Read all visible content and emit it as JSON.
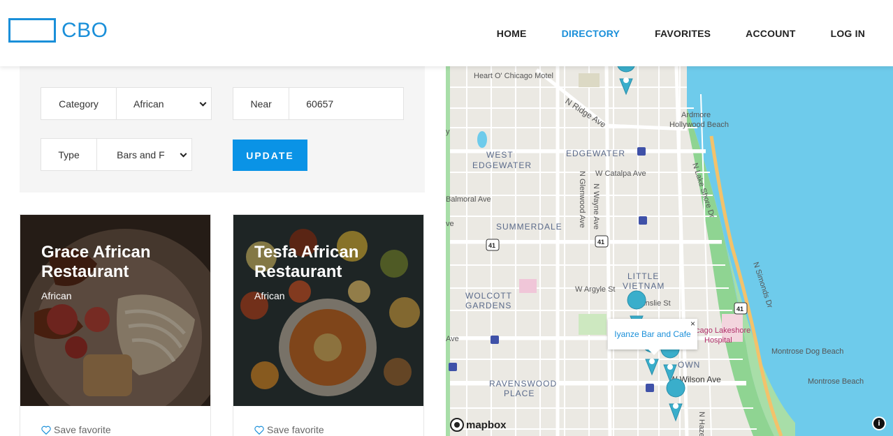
{
  "brand": {
    "name": "CBO",
    "color": "#1a8fd9"
  },
  "nav": {
    "items": [
      {
        "label": "HOME",
        "active": false
      },
      {
        "label": "DIRECTORY",
        "active": true
      },
      {
        "label": "FAVORITES",
        "active": false
      },
      {
        "label": "ACCOUNT",
        "active": false
      },
      {
        "label": "LOG IN",
        "active": false
      }
    ]
  },
  "filters": {
    "category": {
      "label": "Category",
      "value": "African"
    },
    "near": {
      "label": "Near",
      "value": "60657"
    },
    "type": {
      "label": "Type",
      "value": "Bars and F"
    },
    "update_label": "UPDATE",
    "accent": "#0a93e6"
  },
  "cards": [
    {
      "title": "Grace African Restaurant",
      "category": "African",
      "favorite_label": "Save favorite"
    },
    {
      "title": "Tesfa African Restaurant",
      "category": "African",
      "favorite_label": "Save favorite"
    }
  ],
  "map": {
    "popup": {
      "title": "Iyanze Bar and Cafe",
      "close": "×"
    },
    "attribution": "mapbox",
    "info": "i",
    "labels": {
      "motel": "Heart O' Chicago Motel",
      "ridge": "N Ridge Ave",
      "edgewater": "EDGEWATER",
      "west_edgewater_1": "WEST",
      "west_edgewater_2": "EDGEWATER",
      "catalpa": "W Catalpa Ave",
      "ardmore": "Ardmore",
      "hollywood": "Hollywood Beach",
      "lakeshore": "N Lake Shore Dr",
      "glenwood": "N Glenwood Ave",
      "wayne": "N Wayne Ave",
      "balmoral": "Balmoral Ave",
      "summerdale": "SUMMERDALE",
      "ave_left": "ve",
      "little_1": "LITTLE",
      "little_2": "VIETNAM",
      "argyle": "W Argyle St",
      "ainslie": "W Ainslie St",
      "wolcott_1": "WOLCOTT",
      "wolcott_2": "GARDENS",
      "simonds": "N Simonds Dr",
      "hospital_1": "cago Lakeshore",
      "hospital_2": "Hospital",
      "montrose_dog": "Montrose Dog Beach",
      "montrose_beach": "Montrose Beach",
      "wilson": "W Wilson Ave",
      "own": "OWN",
      "ravenswood_1": "RAVENSWOOD",
      "ravenswood_2": "PLACE",
      "hazel": "N Hazel",
      "ave_left2": "Ave",
      "y": "y",
      "hwy": "41"
    }
  }
}
